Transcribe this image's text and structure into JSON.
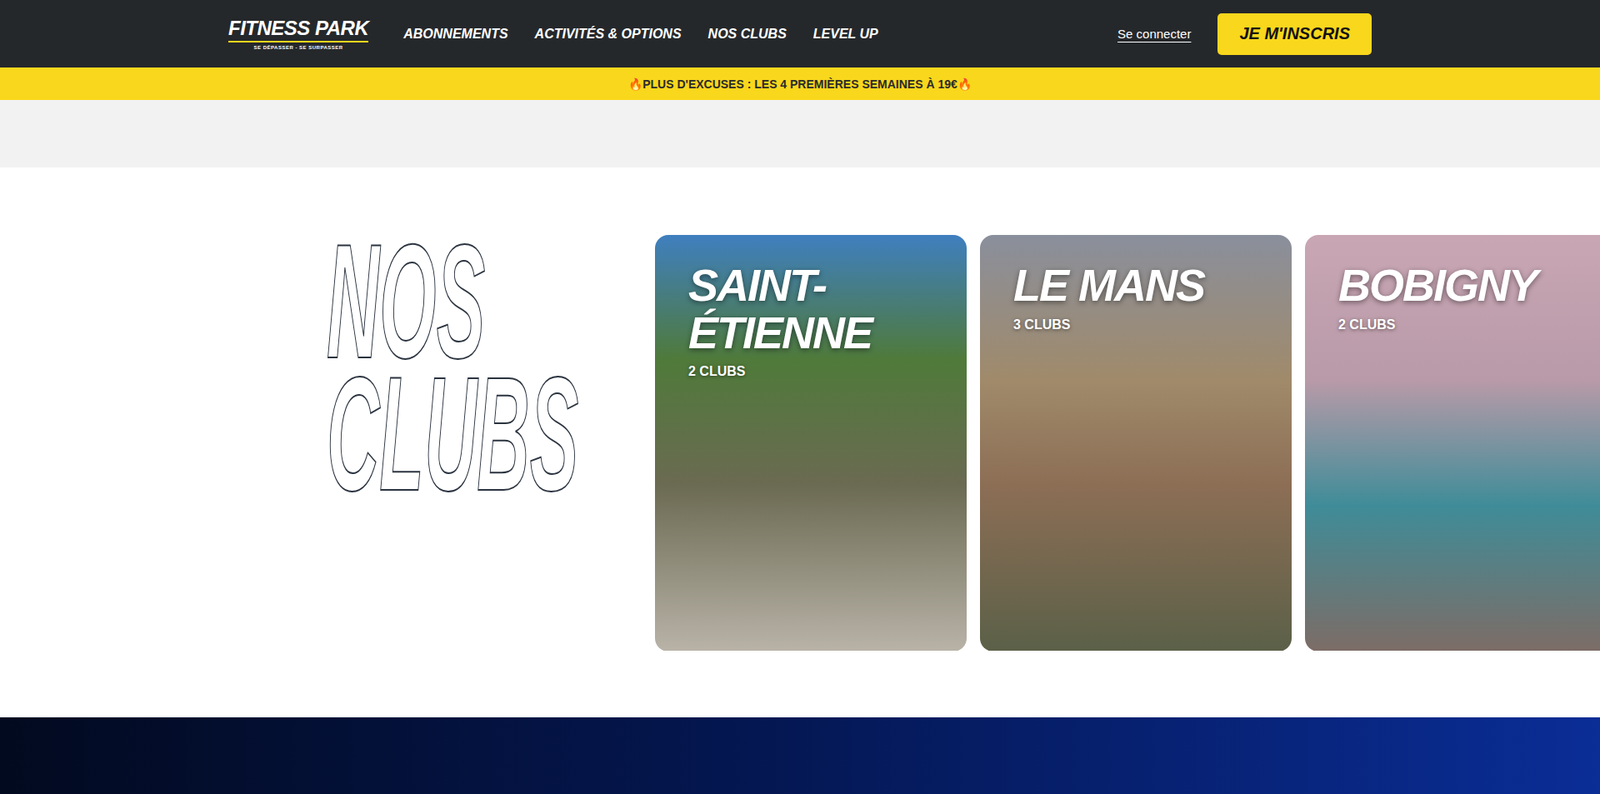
{
  "header": {
    "logo": "FITNESS PARK",
    "tagline": "SE DÉPASSER - SE SURPASSER",
    "nav": [
      "ABONNEMENTS",
      "ACTIVITÉS & OPTIONS",
      "NOS CLUBS",
      "LEVEL UP"
    ],
    "login": "Se connecter",
    "cta": "JE M'INSCRIS"
  },
  "banner": {
    "text": "🔥PLUS D'EXCUSES : LES 4 PREMIÈRES SEMAINES À 19€🔥"
  },
  "section": {
    "title": [
      "NOS",
      "CLUBS"
    ]
  },
  "cities": [
    {
      "name": "SAINT-ÉTIENNE",
      "count": "2 CLUBS"
    },
    {
      "name": "LE MANS",
      "count": "3 CLUBS"
    },
    {
      "name": "BOBIGNY",
      "count": "2 CLUBS"
    }
  ]
}
